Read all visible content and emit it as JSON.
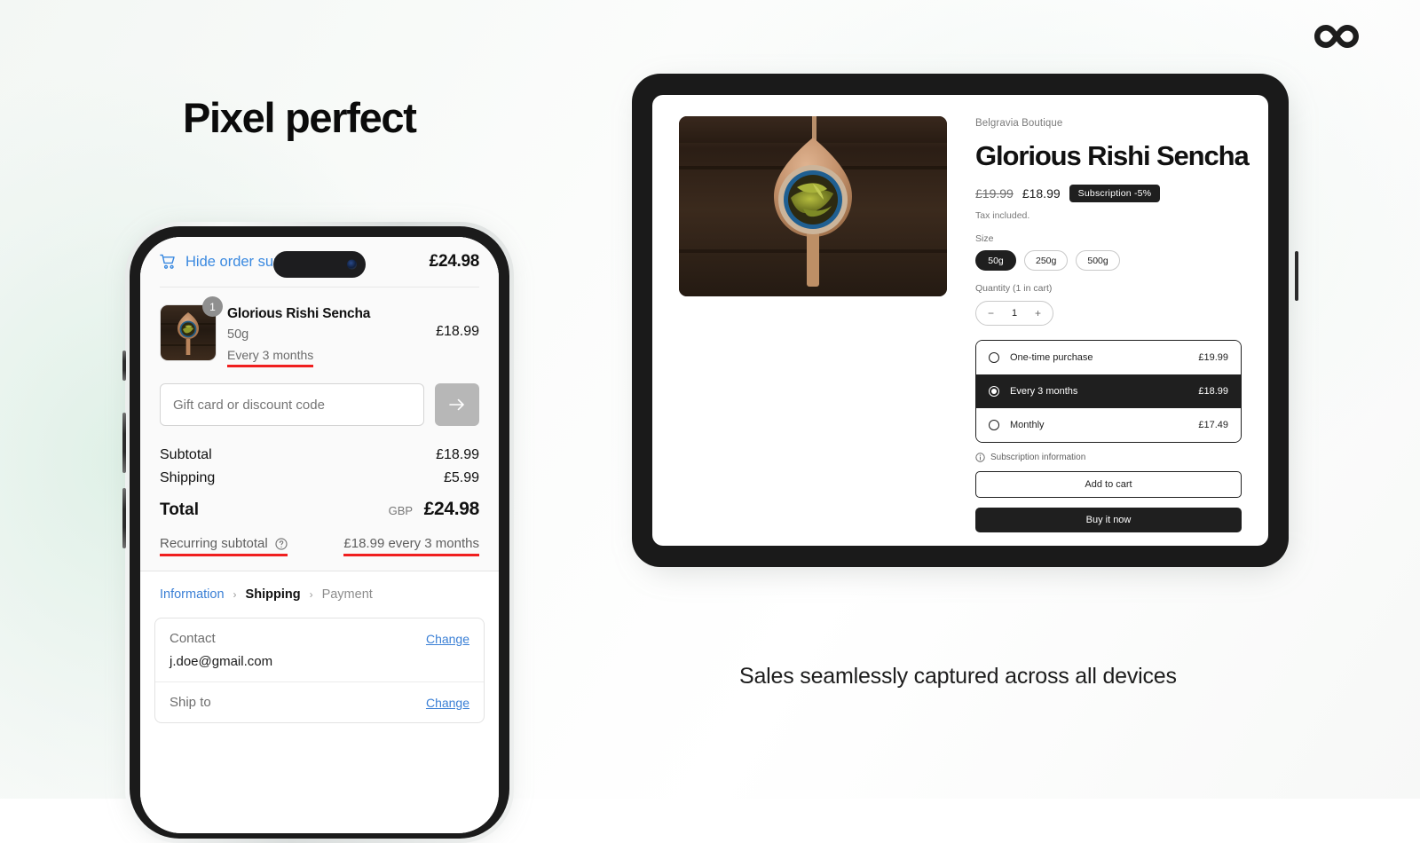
{
  "headline": "Pixel perfect",
  "caption": "Sales seamlessly captured across all devices",
  "logo": {
    "name": "infinity-logo"
  },
  "phone": {
    "order_summary": {
      "toggle_label": "Hide order summary",
      "cart_icon": "cart-icon",
      "chevron_icon": "chevron-up-icon",
      "total": "£24.98",
      "item": {
        "quantity_badge": "1",
        "title": "Glorious Rishi Sencha",
        "variant": "50g",
        "selling_plan": "Every 3 months",
        "price": "£18.99"
      },
      "discount": {
        "placeholder": "Gift card or discount code",
        "value": "",
        "submit_icon": "arrow-right-icon"
      },
      "totals": [
        {
          "label": "Subtotal",
          "value": "£18.99"
        },
        {
          "label": "Shipping",
          "value": "£5.99"
        }
      ],
      "total_row": {
        "label": "Total",
        "currency": "GBP",
        "value": "£24.98"
      },
      "recurring": {
        "label": "Recurring subtotal",
        "help_icon": "question-circle-icon",
        "value": "£18.99 every 3 months"
      }
    },
    "breadcrumbs": [
      {
        "label": "Information",
        "state": "link"
      },
      {
        "label": "Shipping",
        "state": "current"
      },
      {
        "label": "Payment",
        "state": "disabled"
      }
    ],
    "breadcrumb_separator": "›",
    "info_rows": [
      {
        "label": "Contact",
        "action": "Change",
        "value": "j.doe@gmail.com"
      },
      {
        "label": "Ship to",
        "action": "Change",
        "value": ""
      }
    ]
  },
  "tablet": {
    "product": {
      "vendor": "Belgravia Boutique",
      "title": "Glorious Rishi Sencha",
      "price_compare": "£19.99",
      "price_current": "£18.99",
      "badge": "Subscription  -5%",
      "tax_note": "Tax included.",
      "size_label": "Size",
      "sizes": [
        {
          "label": "50g",
          "selected": true
        },
        {
          "label": "250g",
          "selected": false
        },
        {
          "label": "500g",
          "selected": false
        }
      ],
      "quantity_label": "Quantity (1 in cart)",
      "quantity_minus": "−",
      "quantity_value": "1",
      "quantity_plus": "+",
      "plans": [
        {
          "name": "One-time purchase",
          "price": "£19.99",
          "selected": false
        },
        {
          "name": "Every 3 months",
          "price": "£18.99",
          "selected": true
        },
        {
          "name": "Monthly",
          "price": "£17.49",
          "selected": false
        }
      ],
      "subscription_info": "Subscription information",
      "info_icon": "info-circle-icon",
      "add_to_cart": "Add to cart",
      "buy_now": "Buy it now"
    }
  },
  "colors": {
    "accent_blue": "#3a89e0",
    "highlight_red": "#f01f1f",
    "dark": "#1f1f1f"
  }
}
